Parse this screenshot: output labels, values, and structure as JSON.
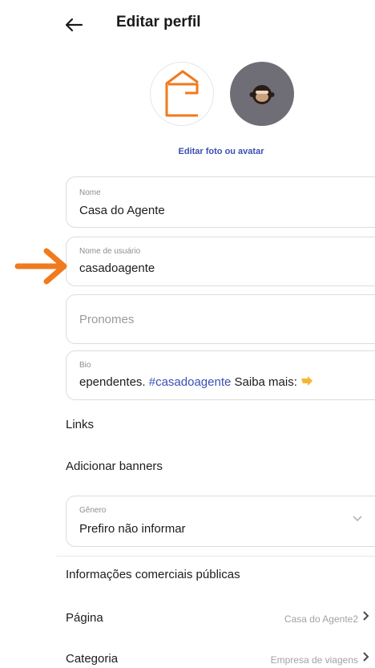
{
  "header": {
    "title": "Editar perfil"
  },
  "avatar": {
    "edit_label": "Editar foto ou avatar"
  },
  "fields": {
    "nome": {
      "label": "Nome",
      "value": "Casa do Agente"
    },
    "username": {
      "label": "Nome de usuário",
      "value": "casadoagente"
    },
    "pronomes": {
      "placeholder": "Pronomes"
    },
    "bio": {
      "label": "Bio",
      "value_prefix": "ependentes. ",
      "hashtag": "#casadoagente",
      "value_suffix": " Saiba mais: "
    },
    "genero": {
      "label": "Gênero",
      "value": "Prefiro não informar"
    }
  },
  "rows": {
    "links": "Links",
    "banners": "Adicionar banners",
    "business_section": "Informações comerciais públicas",
    "pagina": {
      "label": "Página",
      "value": "Casa do Agente2"
    },
    "categoria": {
      "label": "Categoria",
      "value": "Empresa de viagens"
    }
  },
  "colors": {
    "accent_orange": "#f07a1e",
    "link_blue": "#3a4fb5",
    "avatar_gray": "#6f6e76"
  },
  "icons": [
    "back-arrow-icon",
    "house-logo-icon",
    "monkey-emoji-icon",
    "chevron-down-icon",
    "chevron-right-icon",
    "pointing-hand-icon",
    "orange-arrow-icon"
  ]
}
